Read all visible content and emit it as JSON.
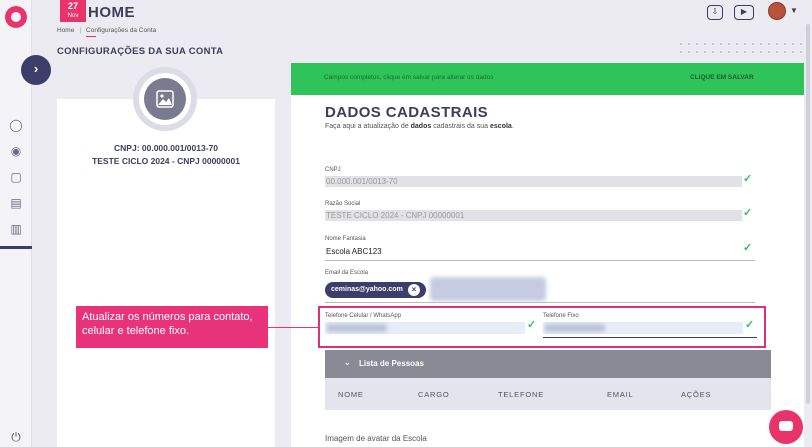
{
  "header": {
    "date_day": "27",
    "date_month": "Nov",
    "title": "HOME",
    "breadcrumb": [
      "Home",
      "Configurações da Conta"
    ],
    "page_heading": "CONFIGURAÇÕES DA SUA CONTA"
  },
  "profile": {
    "cnpj": "CNPJ: 00.000.001/0013-70",
    "name": "TESTE CICLO 2024 - CNPJ 00000001"
  },
  "banner": {
    "message": "Campos completos, clique em salvar para alterar os dados",
    "action": "CLIQUE EM SALVAR"
  },
  "form": {
    "title": "DADOS CADASTRAIS",
    "subtitle_prefix": "Faça aqui a atualização de ",
    "subtitle_bold1": "dados",
    "subtitle_mid": " cadastrais da sua ",
    "subtitle_bold2": "escola",
    "subtitle_end": ".",
    "cnpj_label": "CNPJ",
    "cnpj_value": "00.000.001/0013-70",
    "razao_label": "Razão Social",
    "razao_value": "TESTE CICLO 2024 - CNPJ 00000001",
    "fantasia_label": "Nome Fantasia",
    "fantasia_value": "Escola ABC123",
    "email_label": "Email da Escola",
    "email_chip": "ceminas@yahoo.com",
    "celular_label": "Telefone Celular / WhatsApp",
    "fixo_label": "Telefone Fixo",
    "check": "✓"
  },
  "callout": {
    "text": "Atualizar os números para contato, celular e telefone fixo."
  },
  "people_table": {
    "title": "Lista de Pessoas",
    "columns": [
      "NOME",
      "CARGO",
      "TELEFONE",
      "EMAIL",
      "AÇÕES"
    ]
  },
  "avatar_section": {
    "label": "Imagem de avatar da Escola"
  },
  "colors": {
    "accent": "#e8336b",
    "primary": "#3d3d6b",
    "success": "#2ec45a"
  }
}
